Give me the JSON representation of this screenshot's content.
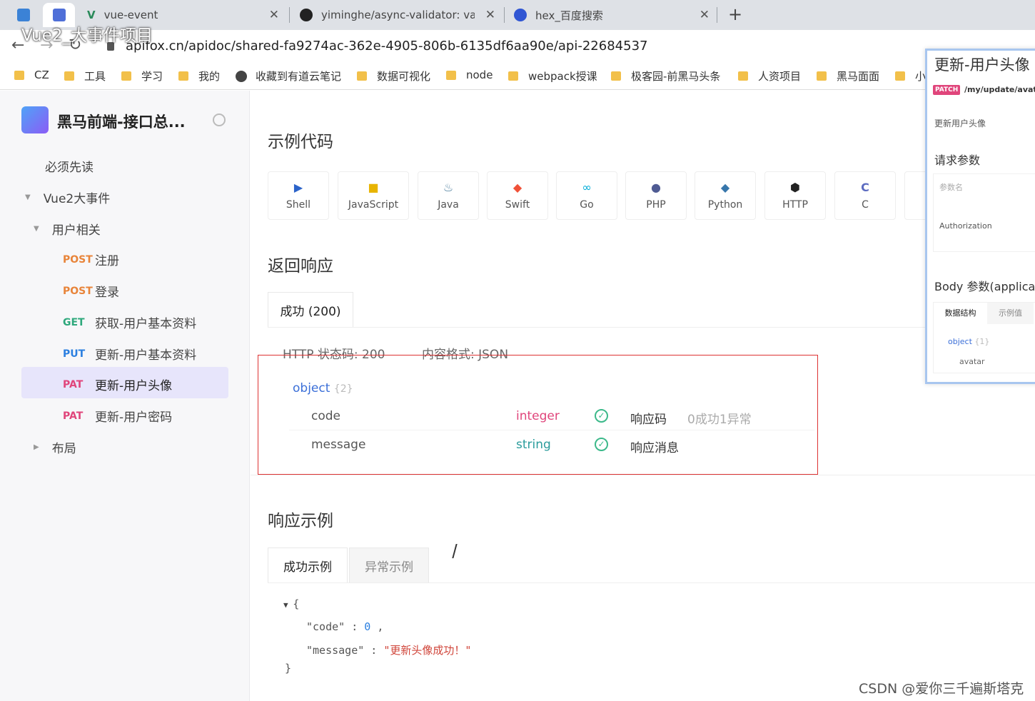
{
  "browser": {
    "tabs": [
      {
        "label": ""
      },
      {
        "label": ""
      },
      {
        "label": "vue-event"
      },
      {
        "label": "yiminghe/async-validator: vali"
      },
      {
        "label": "hex_百度搜索"
      }
    ],
    "overlay_title": "Vue2_大事件项目",
    "url": "apifox.cn/apidoc/shared-fa9274ac-362e-4905-806b-6135df6aa90e/api-22684537",
    "bookmarks": [
      "CZ",
      "工具",
      "学习",
      "我的",
      "收藏到有道云笔记",
      "数据可视化",
      "node",
      "webpack授课",
      "极客园-前黑马头条",
      "人资项目",
      "黑马面面",
      "小"
    ]
  },
  "sidebar": {
    "project_title": "黑马前端-接口总...",
    "items": [
      {
        "label": "必须先读"
      },
      {
        "label": "Vue2大事件"
      },
      {
        "label": "用户相关"
      },
      {
        "method": "POST",
        "label": "注册"
      },
      {
        "method": "POST",
        "label": "登录"
      },
      {
        "method": "GET",
        "label": "获取-用户基本资料"
      },
      {
        "method": "PUT",
        "label": "更新-用户基本资料"
      },
      {
        "method": "PAT",
        "label": "更新-用户头像"
      },
      {
        "method": "PAT",
        "label": "更新-用户密码"
      },
      {
        "label": "布局"
      }
    ]
  },
  "main": {
    "example_code_title": "示例代码",
    "languages": [
      "Shell",
      "JavaScript",
      "Java",
      "Swift",
      "Go",
      "PHP",
      "Python",
      "HTTP",
      "C"
    ],
    "response_title": "返回响应",
    "response_tab": "成功 (200)",
    "status_label": "HTTP 状态码: 200",
    "content_type": "内容格式: JSON",
    "object_label": "object",
    "object_count": "{2}",
    "fields": [
      {
        "name": "code",
        "type": "integer",
        "desc": "响应码",
        "note": "0成功1异常"
      },
      {
        "name": "message",
        "type": "string",
        "desc": "响应消息",
        "note": ""
      }
    ],
    "example_title": "响应示例",
    "example_tabs": [
      "成功示例",
      "异常示例"
    ],
    "code": {
      "open": "{",
      "key1": "\"code\"",
      "val1": "0",
      "key2": "\"message\"",
      "val2": "\"更新头像成功！\"",
      "close": "}"
    }
  },
  "right_panel": {
    "title": "更新-用户头像",
    "method_badge": "PATCH",
    "path": "/my/update/avatar",
    "subtitle": "更新用户头像",
    "params_title": "请求参数",
    "param_header": "参数名",
    "param_name": "Authorization",
    "body_title": "Body 参数(application",
    "tabs": [
      "数据结构",
      "示例值"
    ],
    "object_label": "object",
    "object_count": "{1}",
    "field": "avatar"
  },
  "watermark": "CSDN @爱你三千遍斯塔克",
  "colors": {
    "post": "#e8843a",
    "get": "#2ea87c",
    "put": "#2b7fe0",
    "patch": "#e0457b",
    "highlight": "#dd3333"
  }
}
